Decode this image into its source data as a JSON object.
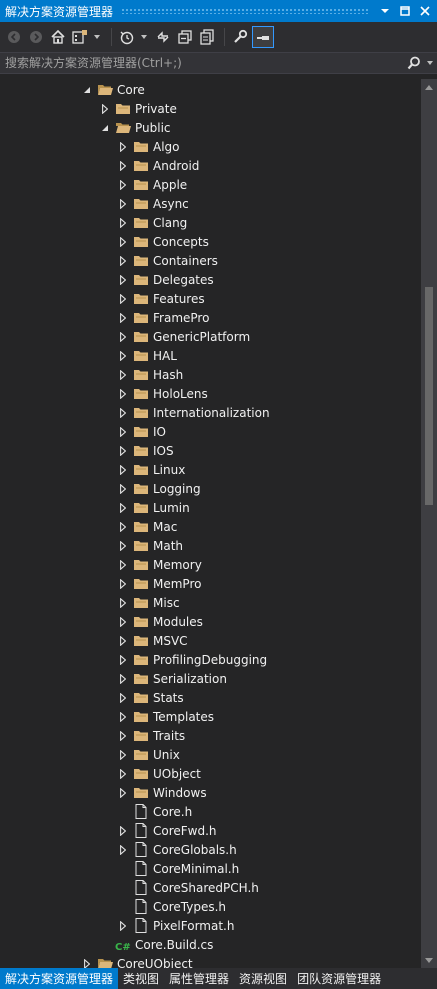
{
  "window": {
    "title": "解决方案资源管理器"
  },
  "toolbar": {
    "icons": [
      "back-icon",
      "forward-icon",
      "home-icon",
      "switch-views-icon",
      "dropdown",
      "history-icon",
      "dropdown",
      "collapse-all-icon",
      "sync-icon",
      "show-all-files-icon",
      "properties-icon",
      "preview-icon"
    ]
  },
  "search": {
    "placeholder": "搜索解决方案资源管理器(Ctrl+;)"
  },
  "tree": {
    "items": [
      {
        "label": "Core",
        "level": 0,
        "arrow": "expanded",
        "icon": "project"
      },
      {
        "label": "Private",
        "level": 1,
        "arrow": "collapsed",
        "icon": "folder"
      },
      {
        "label": "Public",
        "level": 1,
        "arrow": "expanded",
        "icon": "folder-open"
      },
      {
        "label": "Algo",
        "level": 2,
        "arrow": "collapsed",
        "icon": "folder"
      },
      {
        "label": "Android",
        "level": 2,
        "arrow": "collapsed",
        "icon": "folder"
      },
      {
        "label": "Apple",
        "level": 2,
        "arrow": "collapsed",
        "icon": "folder"
      },
      {
        "label": "Async",
        "level": 2,
        "arrow": "collapsed",
        "icon": "folder"
      },
      {
        "label": "Clang",
        "level": 2,
        "arrow": "collapsed",
        "icon": "folder"
      },
      {
        "label": "Concepts",
        "level": 2,
        "arrow": "collapsed",
        "icon": "folder"
      },
      {
        "label": "Containers",
        "level": 2,
        "arrow": "collapsed",
        "icon": "folder"
      },
      {
        "label": "Delegates",
        "level": 2,
        "arrow": "collapsed",
        "icon": "folder"
      },
      {
        "label": "Features",
        "level": 2,
        "arrow": "collapsed",
        "icon": "folder"
      },
      {
        "label": "FramePro",
        "level": 2,
        "arrow": "collapsed",
        "icon": "folder"
      },
      {
        "label": "GenericPlatform",
        "level": 2,
        "arrow": "collapsed",
        "icon": "folder"
      },
      {
        "label": "HAL",
        "level": 2,
        "arrow": "collapsed",
        "icon": "folder"
      },
      {
        "label": "Hash",
        "level": 2,
        "arrow": "collapsed",
        "icon": "folder"
      },
      {
        "label": "HoloLens",
        "level": 2,
        "arrow": "collapsed",
        "icon": "folder"
      },
      {
        "label": "Internationalization",
        "level": 2,
        "arrow": "collapsed",
        "icon": "folder"
      },
      {
        "label": "IO",
        "level": 2,
        "arrow": "collapsed",
        "icon": "folder"
      },
      {
        "label": "IOS",
        "level": 2,
        "arrow": "collapsed",
        "icon": "folder"
      },
      {
        "label": "Linux",
        "level": 2,
        "arrow": "collapsed",
        "icon": "folder"
      },
      {
        "label": "Logging",
        "level": 2,
        "arrow": "collapsed",
        "icon": "folder"
      },
      {
        "label": "Lumin",
        "level": 2,
        "arrow": "collapsed",
        "icon": "folder"
      },
      {
        "label": "Mac",
        "level": 2,
        "arrow": "collapsed",
        "icon": "folder"
      },
      {
        "label": "Math",
        "level": 2,
        "arrow": "collapsed",
        "icon": "folder"
      },
      {
        "label": "Memory",
        "level": 2,
        "arrow": "collapsed",
        "icon": "folder"
      },
      {
        "label": "MemPro",
        "level": 2,
        "arrow": "collapsed",
        "icon": "folder"
      },
      {
        "label": "Misc",
        "level": 2,
        "arrow": "collapsed",
        "icon": "folder"
      },
      {
        "label": "Modules",
        "level": 2,
        "arrow": "collapsed",
        "icon": "folder"
      },
      {
        "label": "MSVC",
        "level": 2,
        "arrow": "collapsed",
        "icon": "folder"
      },
      {
        "label": "ProfilingDebugging",
        "level": 2,
        "arrow": "collapsed",
        "icon": "folder"
      },
      {
        "label": "Serialization",
        "level": 2,
        "arrow": "collapsed",
        "icon": "folder"
      },
      {
        "label": "Stats",
        "level": 2,
        "arrow": "collapsed",
        "icon": "folder"
      },
      {
        "label": "Templates",
        "level": 2,
        "arrow": "collapsed",
        "icon": "folder"
      },
      {
        "label": "Traits",
        "level": 2,
        "arrow": "collapsed",
        "icon": "folder"
      },
      {
        "label": "Unix",
        "level": 2,
        "arrow": "collapsed",
        "icon": "folder"
      },
      {
        "label": "UObject",
        "level": 2,
        "arrow": "collapsed",
        "icon": "folder"
      },
      {
        "label": "Windows",
        "level": 2,
        "arrow": "collapsed",
        "icon": "folder"
      },
      {
        "label": "Core.h",
        "level": 2,
        "arrow": "none",
        "icon": "file"
      },
      {
        "label": "CoreFwd.h",
        "level": 2,
        "arrow": "collapsed",
        "icon": "file"
      },
      {
        "label": "CoreGlobals.h",
        "level": 2,
        "arrow": "collapsed",
        "icon": "file"
      },
      {
        "label": "CoreMinimal.h",
        "level": 2,
        "arrow": "none",
        "icon": "file"
      },
      {
        "label": "CoreSharedPCH.h",
        "level": 2,
        "arrow": "none",
        "icon": "file"
      },
      {
        "label": "CoreTypes.h",
        "level": 2,
        "arrow": "none",
        "icon": "file"
      },
      {
        "label": "PixelFormat.h",
        "level": 2,
        "arrow": "collapsed",
        "icon": "file"
      },
      {
        "label": "Core.Build.cs",
        "level": 1,
        "arrow": "none",
        "icon": "csharp"
      },
      {
        "label": "CoreUObject",
        "level": 0,
        "arrow": "collapsed",
        "icon": "project"
      }
    ]
  },
  "tabs": [
    {
      "label": "解决方案资源管理器",
      "active": true
    },
    {
      "label": "类视图",
      "active": false
    },
    {
      "label": "属性管理器",
      "active": false
    },
    {
      "label": "资源视图",
      "active": false
    },
    {
      "label": "团队资源管理器",
      "active": false
    }
  ],
  "colors": {
    "accent": "#007acc",
    "background": "#252526",
    "folder": "#dcb67a",
    "text": "#f1f1f1"
  }
}
